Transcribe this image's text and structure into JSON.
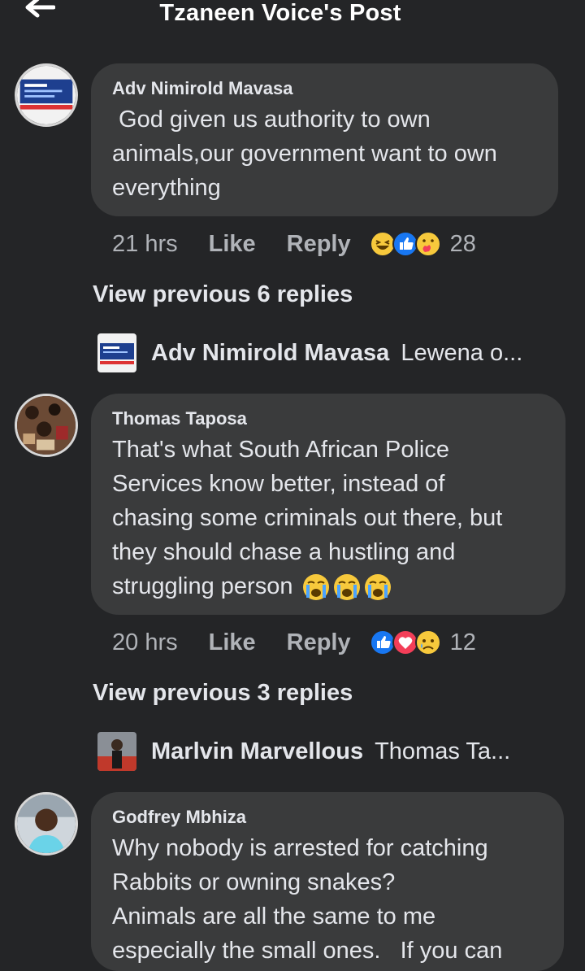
{
  "header": {
    "title": "Tzaneen Voice's Post"
  },
  "comments": [
    {
      "author": "Adv Nimirold Mavasa",
      "lines": [
        " God given us authority to own",
        "animals,our government want to own",
        "everything"
      ],
      "time": "21 hrs",
      "like": "Like",
      "reply": "Reply",
      "reactions": [
        "haha",
        "like",
        "care"
      ],
      "reaction_count": "28",
      "view_previous": "View previous 6 replies",
      "latest_reply": {
        "name": "Adv Nimirold Mavasa",
        "text": "Lewena o..."
      }
    },
    {
      "author": "Thomas Taposa",
      "lines": [
        "That's what South African Police",
        "Services know better, instead of",
        "chasing some criminals out there, but",
        "they should chase a hustling and",
        "struggling person"
      ],
      "emojis": [
        "sob",
        "sob",
        "sob"
      ],
      "time": "20 hrs",
      "like": "Like",
      "reply": "Reply",
      "reactions": [
        "like",
        "love",
        "sad"
      ],
      "reaction_count": "12",
      "view_previous": "View previous 3 replies",
      "latest_reply": {
        "name": "Marlvin Marvellous",
        "text": "Thomas Ta..."
      }
    },
    {
      "author": "Godfrey Mbhiza",
      "lines": [
        "Why nobody is arrested for catching",
        "Rabbits or owning snakes?",
        "Animals are all the same to me",
        "especially the small ones.   If you can"
      ]
    }
  ],
  "colors": {
    "background": "#242527",
    "bubble": "#3a3b3c",
    "text": "#e4e6eb",
    "muted": "#b0b3b8",
    "like_blue": "#1877f2",
    "love_red": "#f33e58",
    "emoji_yellow": "#f7c93c"
  }
}
